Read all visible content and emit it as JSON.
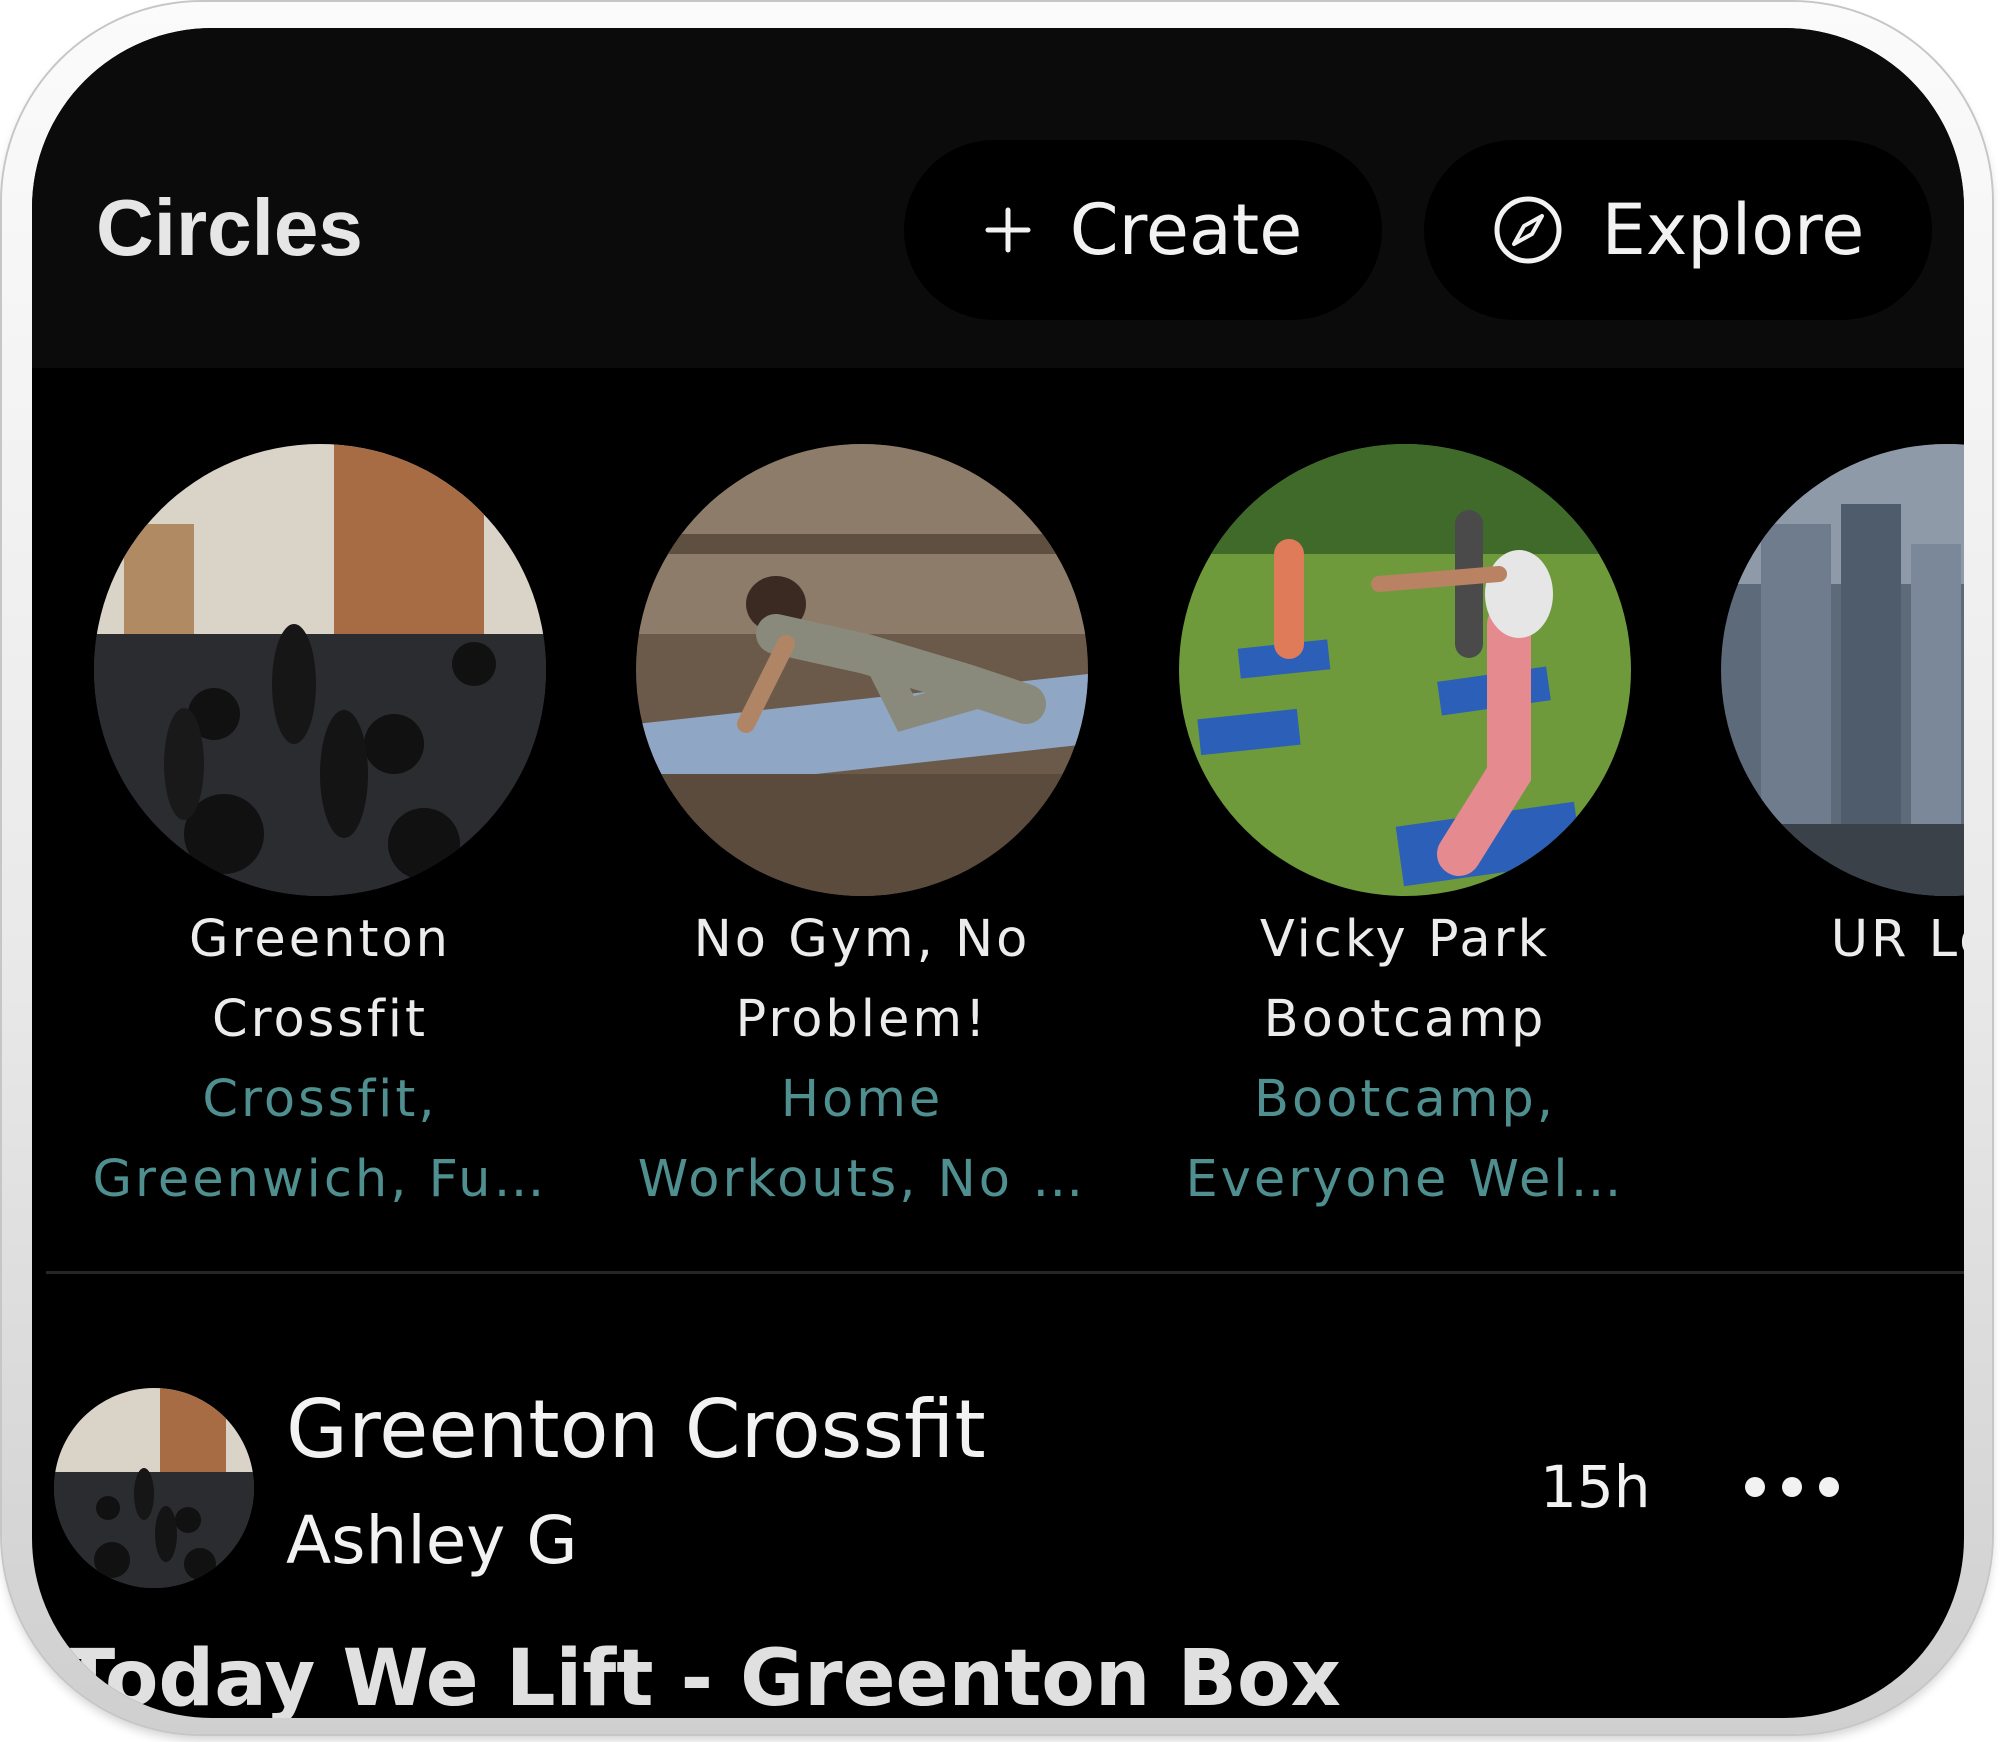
{
  "header": {
    "title": "Circles",
    "create_label": "Create",
    "explore_label": "Explore"
  },
  "circles": [
    {
      "name": "Greenton\nCrossfit",
      "tags": "Crossfit,\nGreenwich, Fu…"
    },
    {
      "name": "No Gym, No\nProblem!",
      "tags": "Home\nWorkouts, No …"
    },
    {
      "name": "Vicky Park\nBootcamp",
      "tags": "Bootcamp,\nEveryone Wel…"
    },
    {
      "name": "UR Lege",
      "tags": ""
    }
  ],
  "post": {
    "circle_name": "Greenton Crossfit",
    "author": "Ashley G",
    "time": "15h",
    "title": "Today We Lift - Greenton Box"
  },
  "colors": {
    "background": "#000000",
    "header_background": "#0b0b0b",
    "text": "#ececec",
    "tag_text": "#4f8f8f"
  },
  "icons": {
    "create": "plus-icon",
    "explore": "compass-icon",
    "more": "more-horizontal-icon"
  }
}
